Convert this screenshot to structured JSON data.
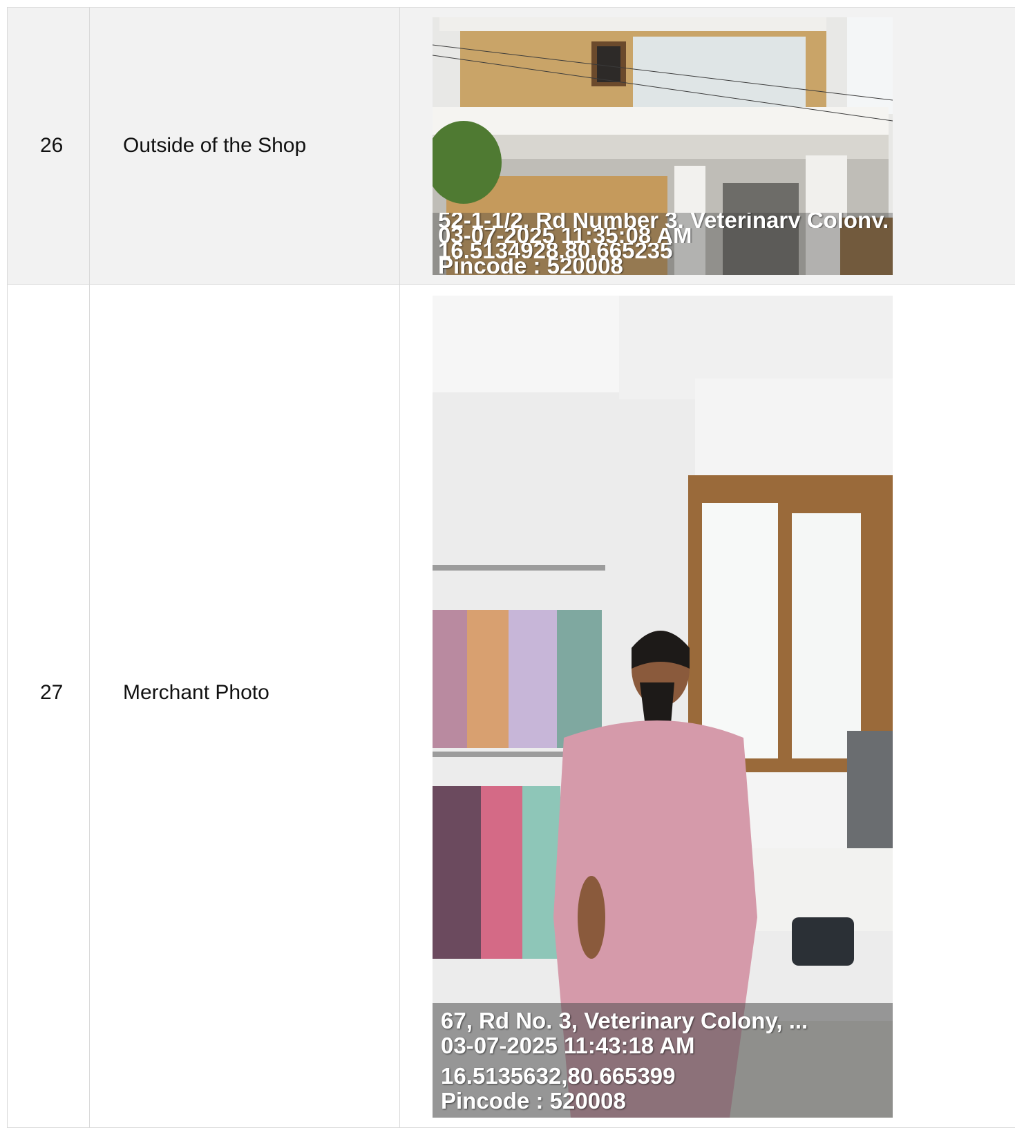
{
  "rows": [
    {
      "number": "26",
      "description": "Outside of the Shop",
      "photo": {
        "subject": "shop-exterior-building",
        "overlay": {
          "address": "52-1-1/2, Rd Number 3, Veterinary Colony, ..",
          "datetime": "03-07-2025 11:35:08 AM",
          "coordinates": "16.5134928,80.665235",
          "pincode": "Pincode : 520008"
        }
      }
    },
    {
      "number": "27",
      "description": "Merchant Photo",
      "photo": {
        "subject": "merchant-in-saree-shop",
        "overlay": {
          "address": "67, Rd No. 3, Veterinary Colony, ...",
          "datetime": "03-07-2025 11:43:18 AM",
          "coordinates": "16.5135632,80.665399",
          "pincode": "Pincode : 520008"
        }
      }
    }
  ]
}
